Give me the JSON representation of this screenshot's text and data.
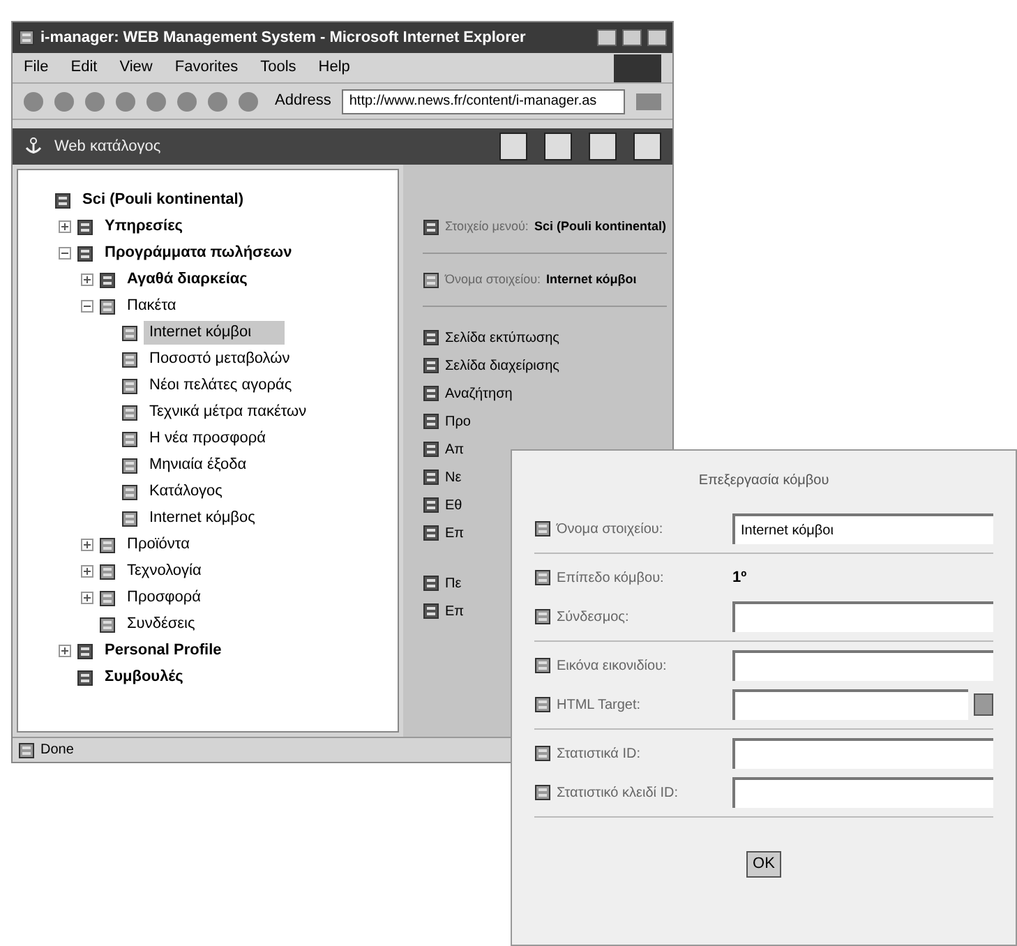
{
  "window": {
    "title": "i-manager: WEB Management System - Microsoft Internet Explorer"
  },
  "menu": [
    "File",
    "Edit",
    "View",
    "Favorites",
    "Tools",
    "Help"
  ],
  "address": {
    "label": "Address",
    "value": "http://www.news.fr/content/i-manager.as"
  },
  "app_header": {
    "title": "Web κατάλογος"
  },
  "tree": [
    {
      "label": "Sci (Pouli kontinental)",
      "bold": true,
      "selected": false,
      "children": [
        {
          "label": "Υπηρεσίες",
          "bold": true,
          "expanded": false,
          "selected": false
        },
        {
          "label": "Προγράμματα πωλήσεων",
          "bold": true,
          "expanded": true,
          "selected": false,
          "children": [
            {
              "label": "Αγαθά διαρκείας",
              "bold": true,
              "expanded": false,
              "selected": false
            },
            {
              "label": "Πακέτα",
              "bold": false,
              "expanded": true,
              "selected": false,
              "children": [
                {
                  "label": "Internet κόμβοι",
                  "bold": false,
                  "selected": true
                },
                {
                  "label": "Ποσοστό μεταβολών",
                  "bold": false,
                  "selected": false
                },
                {
                  "label": "Νέοι πελάτες αγοράς",
                  "bold": false,
                  "selected": false
                },
                {
                  "label": "Τεχνικά μέτρα πακέτων",
                  "bold": false,
                  "selected": false
                },
                {
                  "label": "Η νέα προσφορά",
                  "bold": false,
                  "selected": false
                },
                {
                  "label": "Μηνιαία έξοδα",
                  "bold": false,
                  "selected": false
                },
                {
                  "label": "Κατάλογος",
                  "bold": false,
                  "selected": false
                },
                {
                  "label": "Internet κόμβος",
                  "bold": false,
                  "selected": false
                }
              ]
            },
            {
              "label": "Προϊόντα",
              "bold": false,
              "expanded": false,
              "selected": false
            },
            {
              "label": "Τεχνολογία",
              "bold": false,
              "expanded": false,
              "selected": false
            },
            {
              "label": "Προσφορά",
              "bold": false,
              "expanded": false,
              "selected": false
            },
            {
              "label": "Συνδέσεις",
              "bold": false,
              "selected": false
            }
          ]
        },
        {
          "label": "Personal Profile",
          "bold": true,
          "expanded": false,
          "selected": false
        },
        {
          "label": "Συμβουλές",
          "bold": true,
          "selected": false
        }
      ]
    }
  ],
  "details": [
    {
      "label": "Στοιχείο μενού:",
      "value": "Sci (Pouli kontinental)"
    },
    {
      "label": "Όνομα στοιχείου:",
      "value": "Internet κόμβοι"
    }
  ],
  "actions": [
    "Σελίδα εκτύπωσης",
    "Σελίδα διαχείρισης",
    "Αναζήτηση",
    "Προ",
    "Απ",
    "Νε",
    "Εθ",
    "Επ"
  ],
  "actions_lower": [
    "Πε",
    "Επ"
  ],
  "status_bar": {
    "text": "Done"
  },
  "dialog": {
    "title": "Επεξεργασία κόμβου",
    "groups": [
      [
        {
          "kind": "input",
          "label": "Όνομα στοιχείου:",
          "value": "Internet κόμβοι"
        }
      ],
      [
        {
          "kind": "text",
          "label": "Επίπεδο κόμβου:",
          "value": "1º"
        },
        {
          "kind": "input",
          "label": "Σύνδεσμος:"
        }
      ],
      [
        {
          "kind": "input",
          "label": "Εικόνα εικονιδίου:"
        },
        {
          "kind": "browse",
          "label": "HTML Target:"
        }
      ],
      [
        {
          "kind": "input",
          "label": "Στατιστικά ID:"
        },
        {
          "kind": "input",
          "label": "Στατιστικό κλειδί ID:"
        }
      ]
    ],
    "ok": "OK"
  }
}
